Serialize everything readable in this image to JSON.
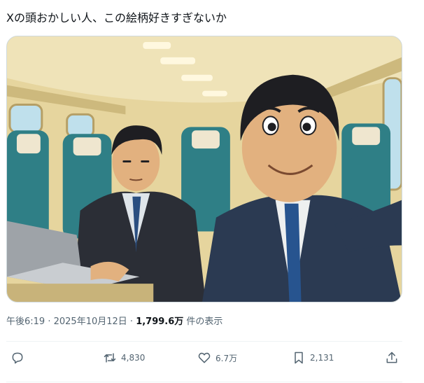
{
  "post": {
    "text": "Xの頭おかしい人、この絵柄好きすぎないか"
  },
  "meta": {
    "time": "午後6:19",
    "separator": " · ",
    "date": "2025年10月12日",
    "separator2": " · ",
    "views_count": "1,799.6万",
    "views_label": " 件の表示"
  },
  "actions": {
    "reply": {
      "icon": "reply-icon",
      "count": ""
    },
    "retweet": {
      "icon": "retweet-icon",
      "count": "4,830"
    },
    "like": {
      "icon": "heart-icon",
      "count": "6.7万"
    },
    "bookmark": {
      "icon": "bookmark-icon",
      "count": "2,131"
    },
    "share": {
      "icon": "share-icon",
      "count": ""
    }
  },
  "media": {
    "kind": "illustration",
    "description_colors": {
      "ceiling": "#efe3b8",
      "wall": "#e6d59e",
      "seat": "#2f7f86",
      "suit": "#2b3a52",
      "skin": "#e2b17f"
    }
  }
}
